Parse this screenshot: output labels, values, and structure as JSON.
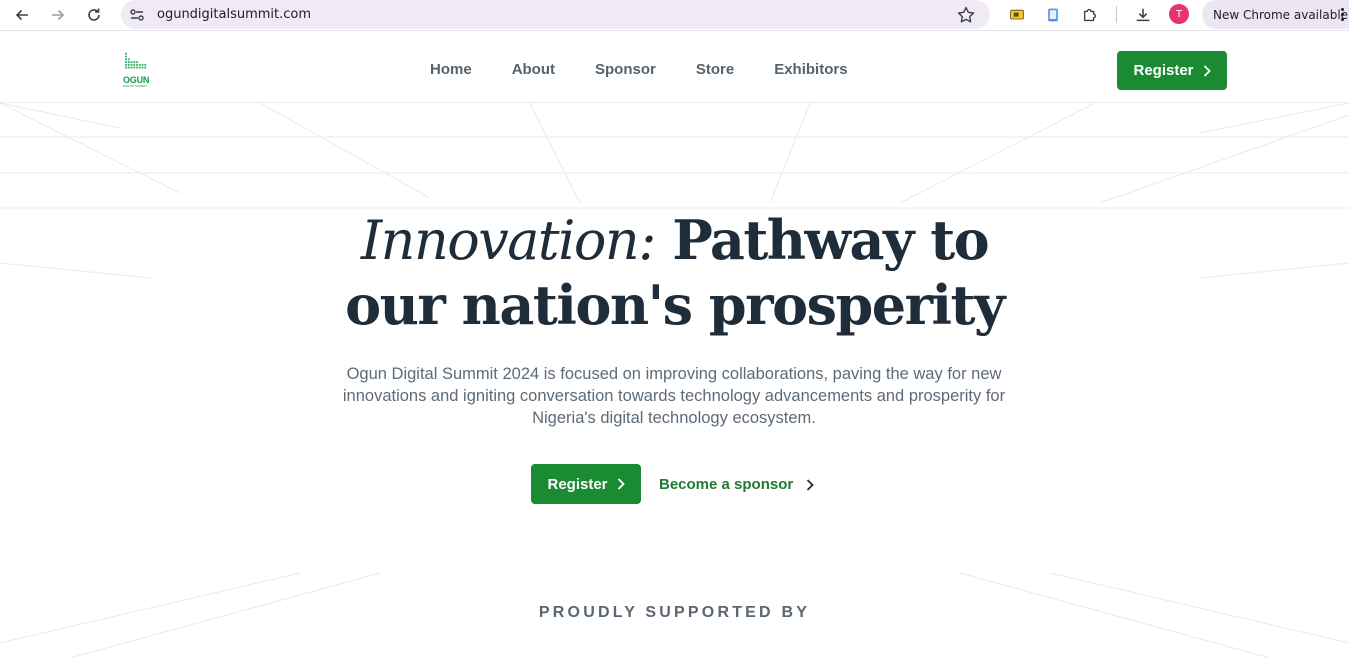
{
  "browser": {
    "url": "ogundigitalsummit.com",
    "avatar_initial": "T",
    "update_label": "New Chrome available",
    "icons": [
      "back-icon",
      "forward-icon",
      "reload-icon",
      "site-info-icon",
      "star-icon",
      "extension-icons",
      "downloads-icon",
      "kebab-menu-icon"
    ]
  },
  "header": {
    "logo_text": "OGUN",
    "logo_subtext": "DIGITAL SUMMIT",
    "nav": [
      {
        "label": "Home"
      },
      {
        "label": "About"
      },
      {
        "label": "Sponsor"
      },
      {
        "label": "Store"
      },
      {
        "label": "Exhibitors"
      }
    ],
    "register_label": "Register"
  },
  "hero": {
    "title_italic": "Innovation:",
    "title_rest_line1": " Pathway to",
    "title_line2": "our nation's prosperity",
    "subtitle": "Ogun Digital Summit 2024 is focused on improving collaborations, paving the way for new innovations and igniting conversation towards technology advancements and prosperity for Nigeria's digital technology ecosystem.",
    "register_label": "Register",
    "sponsor_label": "Become a sponsor"
  },
  "supported_by": "PROUDLY SUPPORTED BY",
  "colors": {
    "brand_green": "#1a8a33",
    "heading": "#1f2d3a",
    "body_text": "#5d6b78"
  }
}
